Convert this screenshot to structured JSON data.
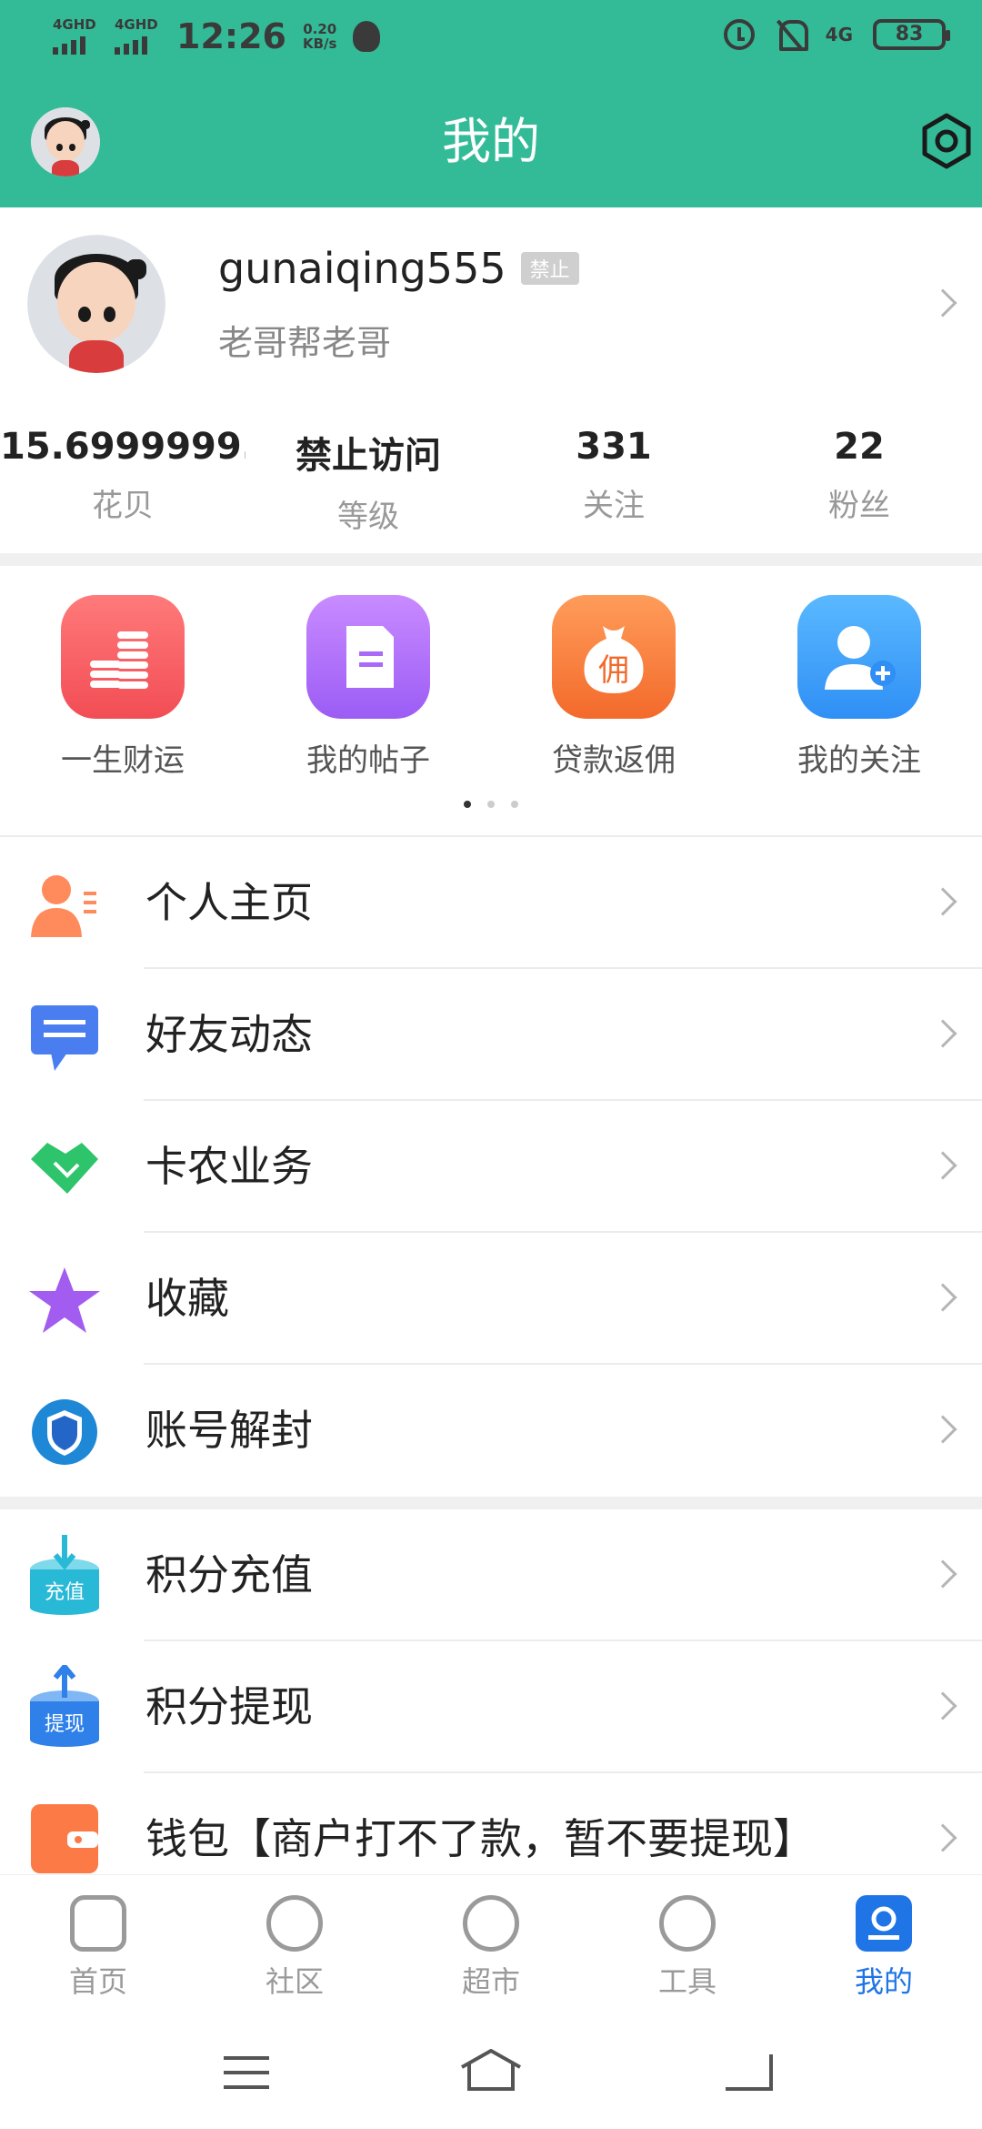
{
  "status_bar": {
    "signal1": "4GHD",
    "signal2": "4GHD",
    "time": "12:26",
    "speed_value": "0.20",
    "speed_unit": "KB/s",
    "network": "4G",
    "battery": "83"
  },
  "header": {
    "title": "我的",
    "accent_color": "#33bb97"
  },
  "profile": {
    "username": "gunaiqing555",
    "tag": "禁止",
    "motto": "老哥帮老哥",
    "stats": [
      {
        "value": "15.6999999...",
        "label": "花贝"
      },
      {
        "value": "禁止访问",
        "label": "等级"
      },
      {
        "value": "331",
        "label": "关注"
      },
      {
        "value": "22",
        "label": "粉丝"
      }
    ]
  },
  "quick_actions": [
    {
      "label": "一生财运",
      "icon": "coins-icon"
    },
    {
      "label": "我的帖子",
      "icon": "document-icon"
    },
    {
      "label": "贷款返佣",
      "icon": "money-bag-icon",
      "glyph": "佣"
    },
    {
      "label": "我的关注",
      "icon": "add-user-icon"
    }
  ],
  "menu_group1": [
    {
      "label": "个人主页",
      "icon": "personal-card-icon"
    },
    {
      "label": "好友动态",
      "icon": "chat-bubble-icon"
    },
    {
      "label": "卡农业务",
      "icon": "handshake-icon"
    },
    {
      "label": "收藏",
      "icon": "star-icon"
    },
    {
      "label": "账号解封",
      "icon": "shield-icon"
    }
  ],
  "menu_group2": [
    {
      "label": "积分充值",
      "icon": "recharge-icon",
      "glyph": "充值"
    },
    {
      "label": "积分提现",
      "icon": "withdraw-icon",
      "glyph": "提现"
    },
    {
      "label": "钱包【商户打不了款，暂不要提现】",
      "icon": "wallet-icon"
    }
  ],
  "tabs": [
    {
      "label": "首页",
      "icon": "home-icon"
    },
    {
      "label": "社区",
      "icon": "community-icon"
    },
    {
      "label": "超市",
      "icon": "market-icon"
    },
    {
      "label": "工具",
      "icon": "compass-icon"
    },
    {
      "label": "我的",
      "icon": "profile-icon",
      "active": true
    }
  ]
}
